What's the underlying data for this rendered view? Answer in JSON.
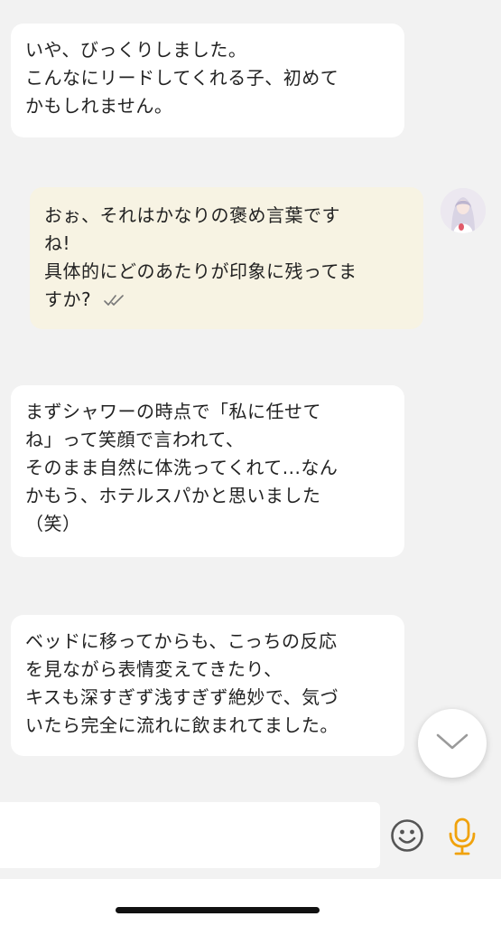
{
  "messages": [
    {
      "direction": "incoming",
      "lines": [
        "いや、びっくりしました。",
        "こんなにリードしてくれる子、初めて",
        "かもしれません。"
      ]
    },
    {
      "direction": "outgoing",
      "lines": [
        "おぉ、それはかなりの褒め言葉です",
        "ね!",
        "具体的にどのあたりが印象に残ってま",
        "すか?"
      ],
      "read_icon": "double-check-icon"
    },
    {
      "direction": "incoming",
      "lines": [
        "まずシャワーの時点で「私に任せて",
        "ね」って笑顔で言われて、",
        "そのまま自然に体洗ってくれて...なん",
        "かもう、ホテルスパかと思いました",
        "（笑）"
      ]
    },
    {
      "direction": "incoming",
      "lines": [
        "ベッドに移ってからも、こっちの反応",
        "を見ながら表情変えてきたり、",
        "キスも深すぎず浅すぎず絶妙で、気づ",
        "いたら完全に流れに飲まれてました。"
      ]
    }
  ],
  "input": {
    "value": "",
    "placeholder": ""
  },
  "icons": {
    "scroll_down": "chevron-down-icon",
    "emoji": "smiley-icon",
    "mic": "microphone-icon"
  },
  "colors": {
    "background": "#f2f2f2",
    "incoming_bubble": "#ffffff",
    "outgoing_bubble": "#f7f3e3",
    "mic_accent": "#f0a20c",
    "emoji_gray": "#555555"
  }
}
